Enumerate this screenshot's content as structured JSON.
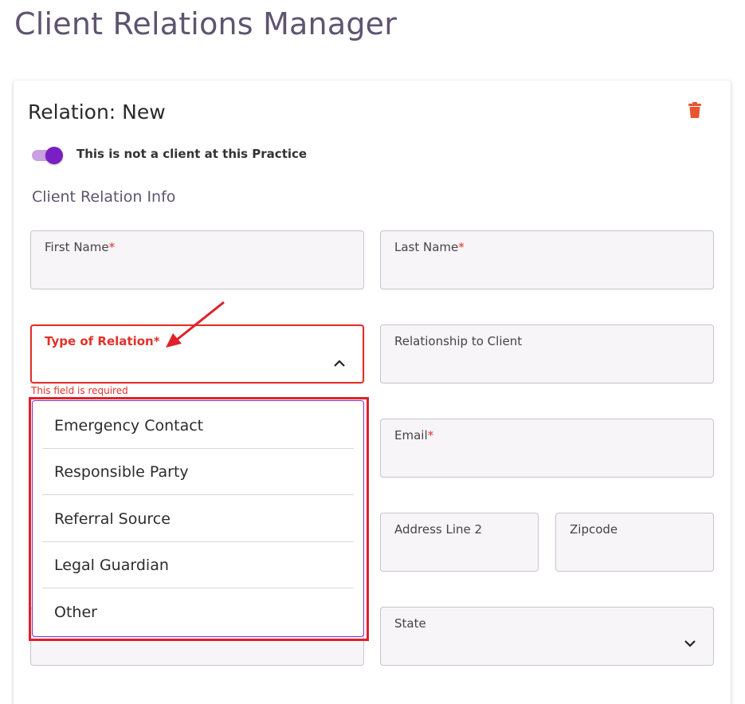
{
  "page": {
    "title": "Client Relations Manager"
  },
  "card": {
    "title": "Relation: New",
    "delete_icon": "trash-icon"
  },
  "toggle": {
    "label": "This is not a client at this Practice",
    "on": true
  },
  "section": {
    "title": "Client Relation Info"
  },
  "fields": {
    "first_name": {
      "label": "First Name",
      "required": "*"
    },
    "last_name": {
      "label": "Last Name",
      "required": "*"
    },
    "type_of_relation": {
      "label": "Type of Relation",
      "required": "*",
      "error": "This field is required"
    },
    "relationship_to_client": {
      "label": "Relationship to Client"
    },
    "email": {
      "label": "Email",
      "required": "*"
    },
    "address_line_2": {
      "label": "Address Line 2"
    },
    "zipcode": {
      "label": "Zipcode"
    },
    "state": {
      "label": "State"
    }
  },
  "dropdown": {
    "options": [
      "Emergency Contact",
      "Responsible Party",
      "Referral Source",
      "Legal Guardian",
      "Other"
    ]
  },
  "colors": {
    "accent": "#7a1fc3",
    "error": "#e0322a",
    "title": "#5f5470",
    "annotation": "#e0202a"
  }
}
